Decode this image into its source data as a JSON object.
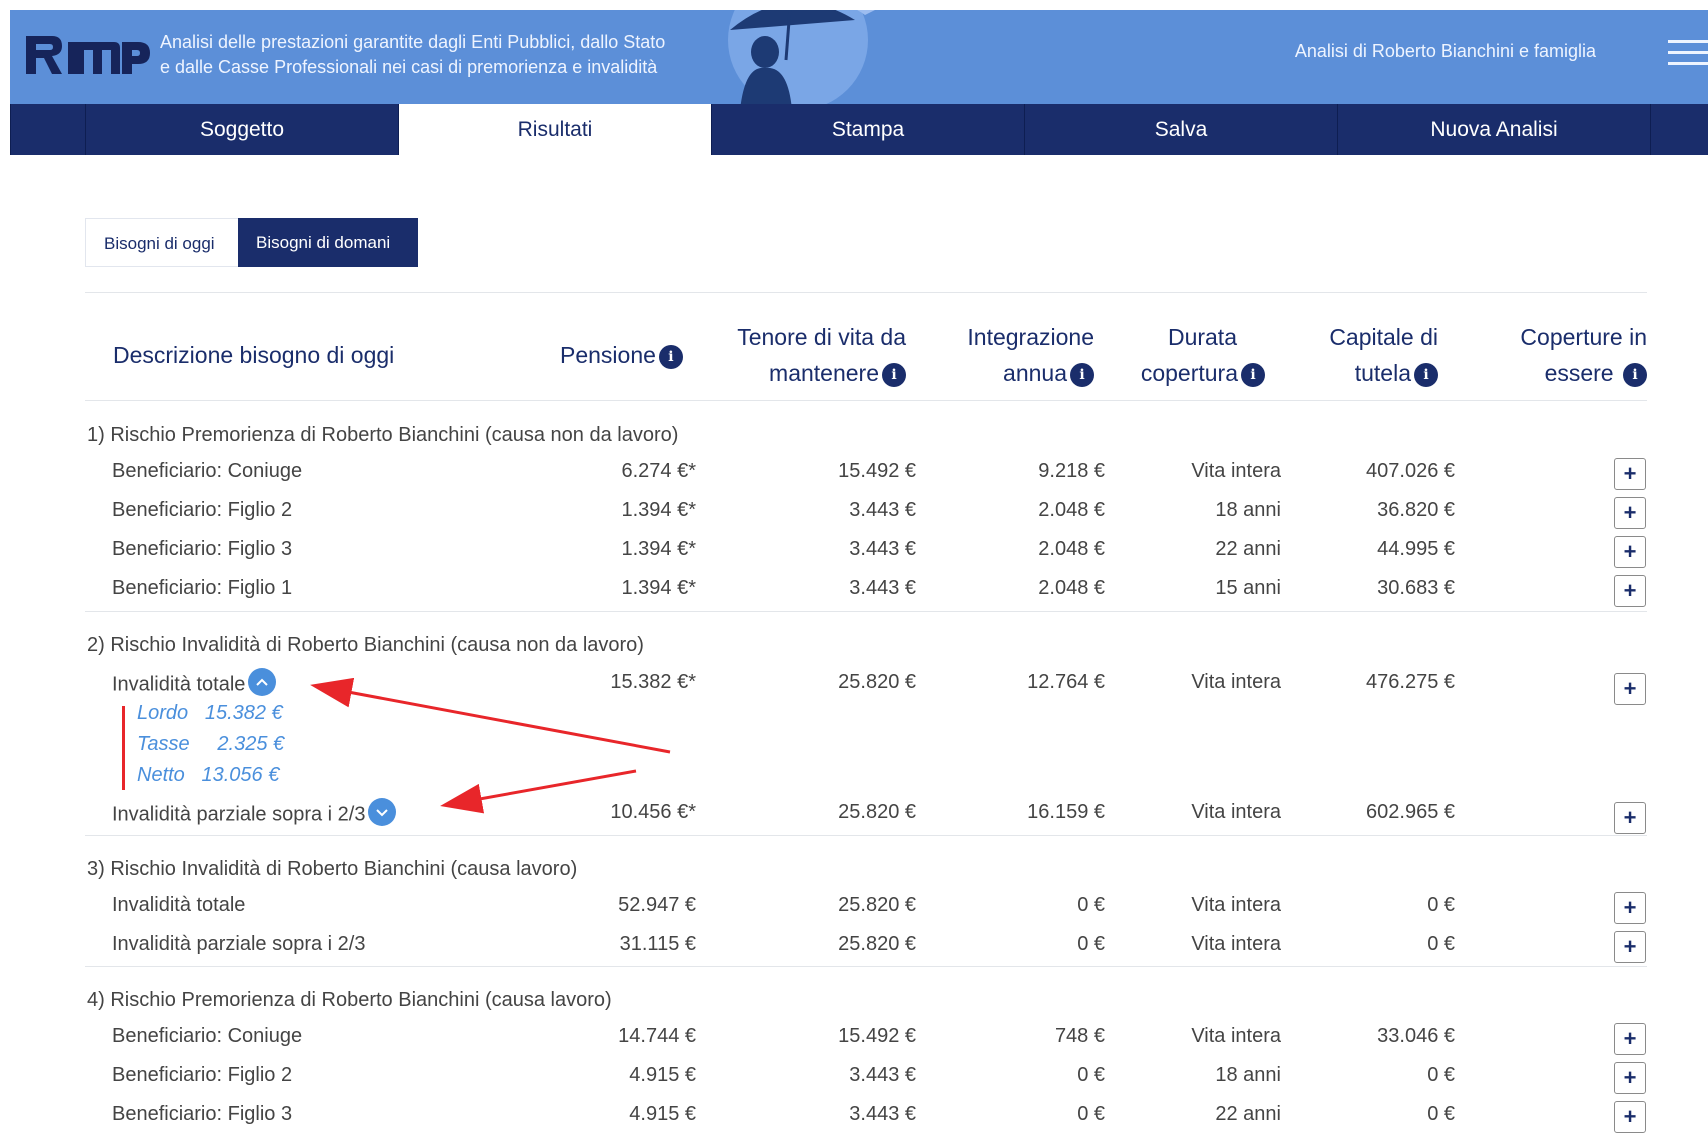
{
  "header": {
    "logo_text": "RMP",
    "tagline_1": "Analisi delle prestazioni garantite dagli Enti Pubblici, dallo Stato",
    "tagline_2": "e dalle Casse Professionali nei casi di premorienza e invalidità",
    "analysis_of": "Analisi di Roberto Bianchini e famiglia"
  },
  "nav": {
    "tabs": [
      "Soggetto",
      "Risultati",
      "Stampa",
      "Salva",
      "Nuova Analisi"
    ],
    "active": "Risultati"
  },
  "subtabs": {
    "oggi": "Bisogni di oggi",
    "domani": "Bisogni di domani"
  },
  "columns": {
    "desc": "Descrizione bisogno di oggi",
    "pensione": "Pensione",
    "tenore_1": "Tenore di vita da",
    "tenore_2": "mantenere",
    "integrazione_1": "Integrazione",
    "integrazione_2": "annua",
    "durata_1": "Durata",
    "durata_2": "copertura",
    "capitale_1": "Capitale di",
    "capitale_2": "tutela",
    "coperture_1": "Coperture in",
    "coperture_2": "essere",
    "info_glyph": "i"
  },
  "sections": [
    {
      "title": "1) Rischio Premorienza di Roberto Bianchini (causa non da lavoro)",
      "rows": [
        {
          "desc": "Beneficiario: Coniuge",
          "pensione": "6.274 €*",
          "tenore": "15.492 €",
          "integrazione": "9.218 €",
          "durata": "Vita intera",
          "capitale": "407.026 €"
        },
        {
          "desc": "Beneficiario: Figlio 2",
          "pensione": "1.394 €*",
          "tenore": "3.443 €",
          "integrazione": "2.048 €",
          "durata": "18 anni",
          "capitale": "36.820 €"
        },
        {
          "desc": "Beneficiario: Figlio 3",
          "pensione": "1.394 €*",
          "tenore": "3.443 €",
          "integrazione": "2.048 €",
          "durata": "22 anni",
          "capitale": "44.995 €"
        },
        {
          "desc": "Beneficiario: Figlio 1",
          "pensione": "1.394 €*",
          "tenore": "3.443 €",
          "integrazione": "2.048 €",
          "durata": "15 anni",
          "capitale": "30.683 €"
        }
      ]
    },
    {
      "title": "2) Rischio Invalidità di Roberto Bianchini (causa non da lavoro)",
      "rows": [
        {
          "desc": "Invalidità totale",
          "pensione": "15.382 €*",
          "tenore": "25.820 €",
          "integrazione": "12.764 €",
          "durata": "Vita intera",
          "capitale": "476.275 €"
        },
        {
          "desc": "Invalidità parziale sopra i 2/3",
          "pensione": "10.456 €*",
          "tenore": "25.820 €",
          "integrazione": "16.159 €",
          "durata": "Vita intera",
          "capitale": "602.965 €"
        }
      ],
      "detail": {
        "lordo": "Lordo   15.382 €",
        "tasse": "Tasse     2.325 €",
        "netto": "Netto   13.056 €"
      }
    },
    {
      "title": "3) Rischio Invalidità di Roberto Bianchini (causa lavoro)",
      "rows": [
        {
          "desc": "Invalidità totale",
          "pensione": "52.947 €",
          "tenore": "25.820 €",
          "integrazione": "0 €",
          "durata": "Vita intera",
          "capitale": "0 €"
        },
        {
          "desc": "Invalidità parziale sopra i 2/3",
          "pensione": "31.115 €",
          "tenore": "25.820 €",
          "integrazione": "0 €",
          "durata": "Vita intera",
          "capitale": "0 €"
        }
      ]
    },
    {
      "title": "4) Rischio Premorienza di Roberto Bianchini (causa lavoro)",
      "rows": [
        {
          "desc": "Beneficiario: Coniuge",
          "pensione": "14.744 €",
          "tenore": "15.492 €",
          "integrazione": "748 €",
          "durata": "Vita intera",
          "capitale": "33.046 €"
        },
        {
          "desc": "Beneficiario: Figlio 2",
          "pensione": "4.915 €",
          "tenore": "3.443 €",
          "integrazione": "0 €",
          "durata": "18 anni",
          "capitale": "0 €"
        },
        {
          "desc": "Beneficiario: Figlio 3",
          "pensione": "4.915 €",
          "tenore": "3.443 €",
          "integrazione": "0 €",
          "durata": "22 anni",
          "capitale": "0 €"
        }
      ]
    }
  ],
  "plus_glyph": "+",
  "colors": {
    "header_bg": "#5c8fd8",
    "nav_bg": "#1a2d6b",
    "accent_blue": "#4a8fdc",
    "annotation_red": "#e8262a"
  }
}
